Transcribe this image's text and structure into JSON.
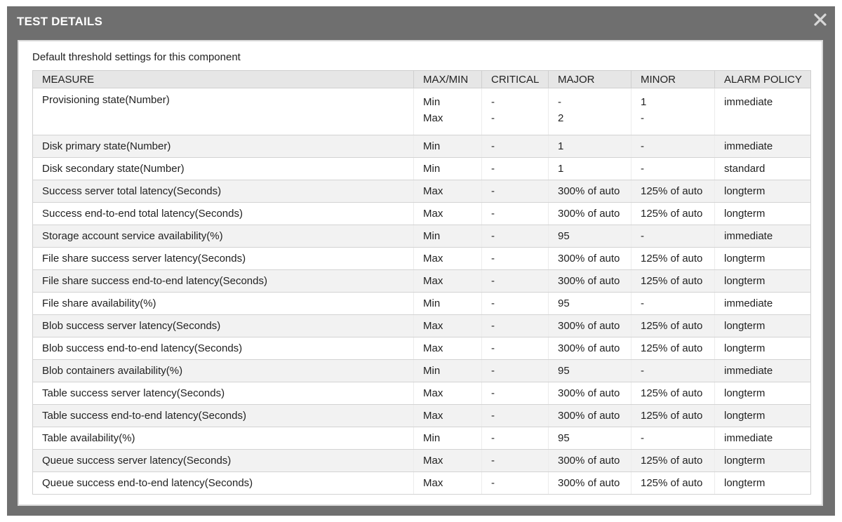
{
  "dialog": {
    "title": "TEST DETAILS",
    "close_icon": "close-icon",
    "subtitle": "Default threshold settings for this component"
  },
  "table": {
    "headers": [
      "MEASURE",
      "MAX/MIN",
      "CRITICAL",
      "MAJOR",
      "MINOR",
      "ALARM POLICY"
    ],
    "first_row": {
      "measure": "Provisioning state(Number)",
      "maxmin": [
        "Min",
        "Max"
      ],
      "critical": [
        "-",
        "-"
      ],
      "major": [
        "-",
        "2"
      ],
      "minor": [
        "1",
        "-"
      ],
      "policy": "immediate"
    },
    "rows": [
      {
        "measure": "Disk primary state(Number)",
        "maxmin": "Min",
        "critical": "-",
        "major": "1",
        "minor": "-",
        "policy": "immediate"
      },
      {
        "measure": "Disk secondary state(Number)",
        "maxmin": "Min",
        "critical": "-",
        "major": "1",
        "minor": "-",
        "policy": "standard"
      },
      {
        "measure": "Success server total latency(Seconds)",
        "maxmin": "Max",
        "critical": "-",
        "major": "300% of auto",
        "minor": "125% of auto",
        "policy": "longterm"
      },
      {
        "measure": "Success end-to-end total latency(Seconds)",
        "maxmin": "Max",
        "critical": "-",
        "major": "300% of auto",
        "minor": "125% of auto",
        "policy": "longterm"
      },
      {
        "measure": "Storage account service availability(%)",
        "maxmin": "Min",
        "critical": "-",
        "major": "95",
        "minor": "-",
        "policy": "immediate"
      },
      {
        "measure": "File share success server latency(Seconds)",
        "maxmin": "Max",
        "critical": "-",
        "major": "300% of auto",
        "minor": "125% of auto",
        "policy": "longterm"
      },
      {
        "measure": "File share success end-to-end latency(Seconds)",
        "maxmin": "Max",
        "critical": "-",
        "major": "300% of auto",
        "minor": "125% of auto",
        "policy": "longterm"
      },
      {
        "measure": "File share availability(%)",
        "maxmin": "Min",
        "critical": "-",
        "major": "95",
        "minor": "-",
        "policy": "immediate"
      },
      {
        "measure": "Blob success server latency(Seconds)",
        "maxmin": "Max",
        "critical": "-",
        "major": "300% of auto",
        "minor": "125% of auto",
        "policy": "longterm"
      },
      {
        "measure": "Blob success end-to-end latency(Seconds)",
        "maxmin": "Max",
        "critical": "-",
        "major": "300% of auto",
        "minor": "125% of auto",
        "policy": "longterm"
      },
      {
        "measure": "Blob containers availability(%)",
        "maxmin": "Min",
        "critical": "-",
        "major": "95",
        "minor": "-",
        "policy": "immediate"
      },
      {
        "measure": "Table success server latency(Seconds)",
        "maxmin": "Max",
        "critical": "-",
        "major": "300% of auto",
        "minor": "125% of auto",
        "policy": "longterm"
      },
      {
        "measure": "Table success end-to-end latency(Seconds)",
        "maxmin": "Max",
        "critical": "-",
        "major": "300% of auto",
        "minor": "125% of auto",
        "policy": "longterm"
      },
      {
        "measure": "Table availability(%)",
        "maxmin": "Min",
        "critical": "-",
        "major": "95",
        "minor": "-",
        "policy": "immediate"
      },
      {
        "measure": "Queue success server latency(Seconds)",
        "maxmin": "Max",
        "critical": "-",
        "major": "300% of auto",
        "minor": "125% of auto",
        "policy": "longterm"
      },
      {
        "measure": "Queue success end-to-end latency(Seconds)",
        "maxmin": "Max",
        "critical": "-",
        "major": "300% of auto",
        "minor": "125% of auto",
        "policy": "longterm"
      }
    ]
  },
  "colors": {
    "frame": "#6f6f6f",
    "header_bg": "#e6e6e6",
    "stripe_bg": "#f2f2f2",
    "title_text": "#ffffff"
  }
}
